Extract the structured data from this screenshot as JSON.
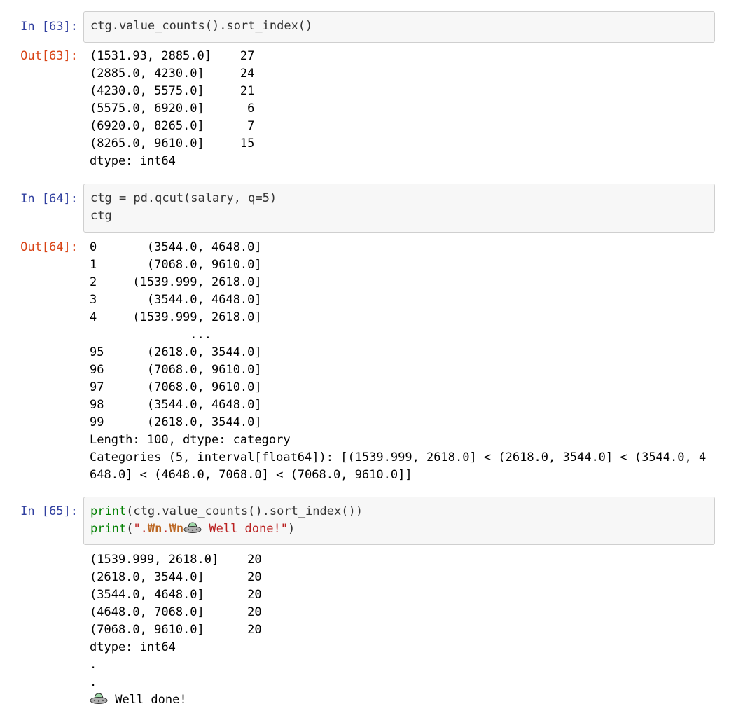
{
  "cells": [
    {
      "in_prompt": "In [63]:",
      "code": [
        "ctg.value_counts().sort_index()"
      ],
      "out_prompt": "Out[63]:",
      "output": [
        "(1531.93, 2885.0]    27",
        "(2885.0, 4230.0]     24",
        "(4230.0, 5575.0]     21",
        "(5575.0, 6920.0]      6",
        "(6920.0, 8265.0]      7",
        "(8265.0, 9610.0]     15",
        "dtype: int64"
      ]
    },
    {
      "in_prompt": "In [64]:",
      "code": [
        "ctg = pd.qcut(salary, q=5)",
        "ctg"
      ],
      "out_prompt": "Out[64]:",
      "output": [
        "0       (3544.0, 4648.0]",
        "1       (7068.0, 9610.0]",
        "2     (1539.999, 2618.0]",
        "3       (3544.0, 4648.0]",
        "4     (1539.999, 2618.0]",
        "              ...",
        "95      (2618.0, 3544.0]",
        "96      (7068.0, 9610.0]",
        "97      (7068.0, 9610.0]",
        "98      (3544.0, 4648.0]",
        "99      (2618.0, 3544.0]",
        "Length: 100, dtype: category"
      ],
      "output_wrap": "Categories (5, interval[float64]): [(1539.999, 2618.0] < (2618.0, 3544.0] < (3544.0, 4648.0] < (4648.0, 7068.0] < (7068.0, 9610.0]]"
    },
    {
      "in_prompt": "In [65]:",
      "code_print1_fn": "print",
      "code_print1_rest": "(ctg.value_counts().sort_index())",
      "code_print2_fn": "print",
      "code_print2_open": "(",
      "code_print2_str_a": "\".",
      "code_print2_esc1": "₩n",
      "code_print2_str_b": ".",
      "code_print2_esc2": "₩n",
      "code_print2_str_c": " Well done!\"",
      "code_print2_close": ")",
      "output": [
        "(1539.999, 2618.0]    20",
        "(2618.0, 3544.0]      20",
        "(3544.0, 4648.0]      20",
        "(4648.0, 7068.0]      20",
        "(7068.0, 9610.0]      20",
        "dtype: int64",
        ".",
        "."
      ],
      "final_text": " Well done!",
      "emoji_icon": "flying-saucer-icon"
    }
  ]
}
